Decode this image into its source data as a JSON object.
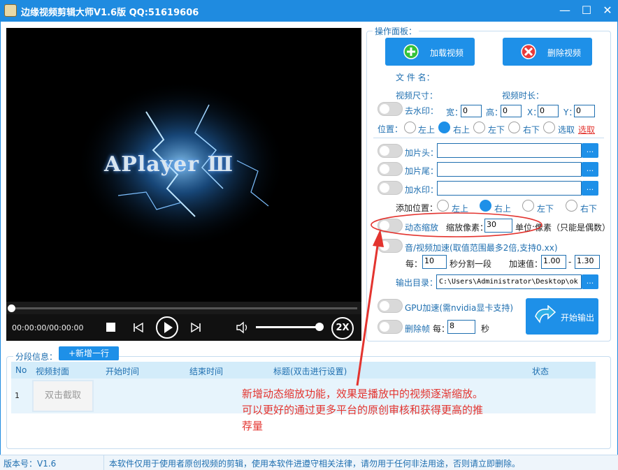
{
  "window": {
    "title": "边缘视频剪辑大师V1.6版  QQ:51619606",
    "minimize": "—",
    "maximize": "☐",
    "close": "✕"
  },
  "player": {
    "logo_text": "APlayer Ⅲ",
    "time": "00:00:00/00:00:00",
    "speed": "2X",
    "seek_fraction": 0,
    "volume_fraction": 0.98
  },
  "panel": {
    "title": "操作面板：",
    "load_button": "加载视频",
    "delete_button": "删除视频",
    "filename_label": "文  件  名：",
    "size_label": "视频尺寸：",
    "duration_label": "视频时长：",
    "watermark_remove": {
      "label": "去水印：",
      "width_label": "宽：",
      "width_value": "0",
      "height_label": "高：",
      "height_value": "0",
      "x_label": "X：",
      "x_value": "0",
      "y_label": "Y：",
      "y_value": "0"
    },
    "position": {
      "label": "位置：",
      "options": [
        "左上",
        "右上",
        "左下",
        "右下",
        "选取"
      ],
      "selected": "右上",
      "select_link": "选取"
    },
    "intro_label": "加片头：",
    "outro_label": "加片尾：",
    "watermark_add_label": "加水印：",
    "browse": "...",
    "add_position": {
      "label": "添加位置：",
      "options": [
        "左上",
        "右上",
        "左下",
        "右下"
      ],
      "selected": "右上"
    },
    "zoom": {
      "label": "动态缩放",
      "pixels_label": "缩放像素：",
      "pixels_value": "30",
      "unit_label": "单位:像素（只能是偶数）"
    },
    "speedup": {
      "label": "音/视频加速(取值范围最多2倍,支持0.xx)",
      "every_label": "每：",
      "every_value": "10",
      "segment_label": "秒分割一段",
      "speed_label": "加速值：",
      "speed_from": "1.00",
      "dash": "-",
      "speed_to": "1.30"
    },
    "output_dir_label": "输出目录：",
    "output_dir_value": "C:\\Users\\Administrator\\Desktop\\ok",
    "gpu_label": "GPU加速(需nvidia显卡支持)",
    "drop_frames": {
      "label": "删除帧",
      "every_label": "每：",
      "value": "8",
      "unit": "秒"
    },
    "start_button": "开始输出"
  },
  "segments": {
    "title": "分段信息：",
    "add_row": "+新增一行",
    "columns": [
      "No",
      "视频封面",
      "开始时间",
      "结束时间",
      "标题(双击进行设置)",
      "状态"
    ],
    "rows": [
      {
        "no": "1",
        "cover": "双击截取"
      }
    ]
  },
  "annotation": "新增动态缩放功能，效果是播放中的视频逐渐缩放。可以更好的通过更多平台的原创审核和获得更高的推荐量",
  "status": {
    "version": "版本号：V1.6",
    "message": "本软件仅用于使用者原创视频的剪辑，使用本软件进遵守相关法律，请勿用于任何非法用途，否则请立即删除。"
  },
  "colors": {
    "accent": "#1e90e8",
    "label": "#1f6fb0",
    "annotation": "#e3342f"
  }
}
